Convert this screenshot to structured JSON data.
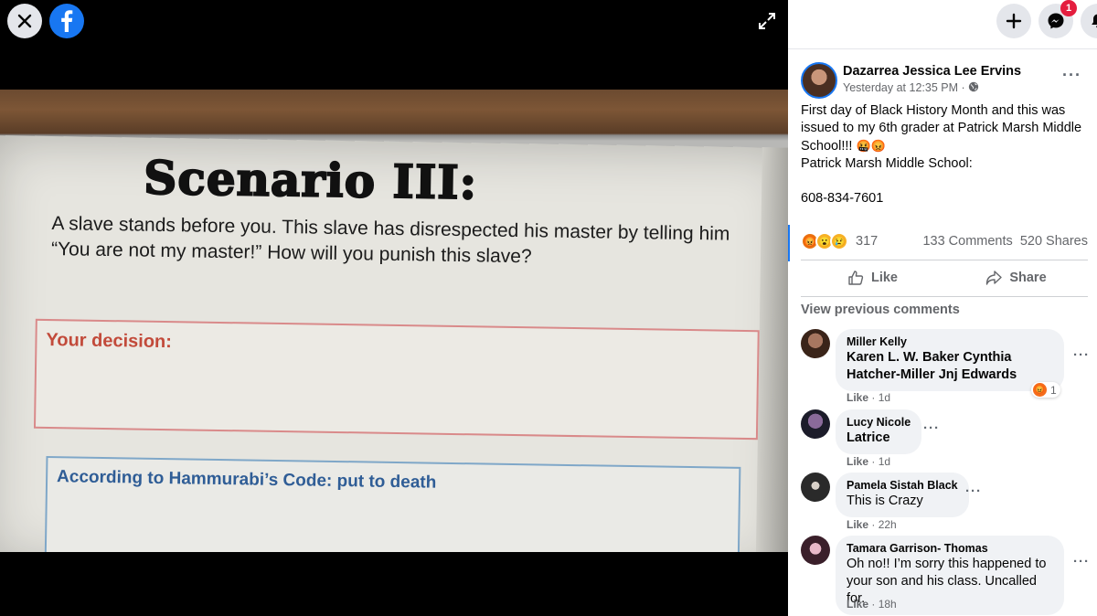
{
  "viewer": {
    "photo": {
      "scenario_title": "Scenario III:",
      "scenario_text": "A slave stands before you.  This slave has disrespected his master by telling him “You are not my master!”  How will you punish this slave?",
      "decision_label": "Your decision:",
      "code_label": "According to Hammurabi’s Code: put to death"
    },
    "close_icon": "close-icon",
    "expand_icon": "expand-icon"
  },
  "topbar": {
    "create_icon": "plus-icon",
    "messenger_icon": "messenger-icon",
    "messenger_badge": "1",
    "notifications_icon": "bell-icon"
  },
  "post": {
    "author": "Dazarrea Jessica Lee Ervins",
    "time": "Yesterday at 12:35 PM ·",
    "body_line1": "First day of Black History Month and this was issued to my 6th grader at Patrick Marsh Middle School!!! ",
    "body_emojis": "🤬😡",
    "body_line2": "Patrick Marsh Middle School:",
    "body_line3": "608-834-7601",
    "reaction_count": "317",
    "comments_count": "133 Comments",
    "shares_count": "520 Shares",
    "like_label": "Like",
    "share_label": "Share",
    "view_previous": "View previous comments"
  },
  "comments": [
    {
      "name": "Miller Kelly",
      "text": "Karen L. W. Baker Cynthia Hatcher-Miller Jnj Edwards",
      "like": "Like",
      "age": "1d",
      "reactions": "1"
    },
    {
      "name": "Lucy Nicole",
      "text": "Latrice",
      "like": "Like",
      "age": "1d"
    },
    {
      "name": "Pamela Sistah Black",
      "text": "This is Crazy",
      "like": "Like",
      "age": "22h"
    },
    {
      "name": "Tamara Garrison- Thomas",
      "text": "Oh no!! I’m sorry this happened to your son and his class. Uncalled for.",
      "like": "Like",
      "age": "18h"
    }
  ],
  "colors": {
    "facebook_blue": "#1877f2",
    "badge_red": "#e41e3f",
    "meta_gray": "#65676b"
  }
}
